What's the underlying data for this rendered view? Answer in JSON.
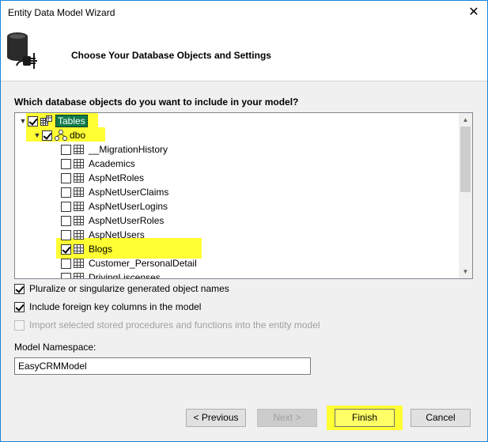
{
  "window": {
    "title": "Entity Data Model Wizard",
    "close_glyph": "✕"
  },
  "header": {
    "title": "Choose Your Database Objects and Settings",
    "icon": "database-plug-icon"
  },
  "objects_section": {
    "label": "Which database objects do you want to include in your model?"
  },
  "tree": {
    "root": {
      "label": "Tables",
      "checked": true,
      "expanded": true,
      "highlighted": true
    },
    "schema": {
      "label": "dbo",
      "checked": true,
      "expanded": true,
      "highlighted": true
    },
    "tables": [
      {
        "label": "__MigrationHistory",
        "checked": false,
        "highlighted": false
      },
      {
        "label": "Academics",
        "checked": false,
        "highlighted": false
      },
      {
        "label": "AspNetRoles",
        "checked": false,
        "highlighted": false
      },
      {
        "label": "AspNetUserClaims",
        "checked": false,
        "highlighted": false
      },
      {
        "label": "AspNetUserLogins",
        "checked": false,
        "highlighted": false
      },
      {
        "label": "AspNetUserRoles",
        "checked": false,
        "highlighted": false
      },
      {
        "label": "AspNetUsers",
        "checked": false,
        "highlighted": false
      },
      {
        "label": "Blogs",
        "checked": true,
        "highlighted": true
      },
      {
        "label": "Customer_PersonalDetail",
        "checked": false,
        "highlighted": false
      },
      {
        "label": "DrivingLiscenses",
        "checked": false,
        "highlighted": false
      }
    ]
  },
  "options": {
    "pluralize": {
      "label": "Pluralize or singularize generated object names",
      "checked": true
    },
    "foreign_keys": {
      "label": "Include foreign key columns in the model",
      "checked": true
    },
    "stored_procs": {
      "label": "Import selected stored procedures and functions into the entity model",
      "checked": false,
      "disabled": true
    }
  },
  "namespace": {
    "label": "Model Namespace:",
    "value": "EasyCRMModel"
  },
  "buttons": {
    "previous": "< Previous",
    "next": "Next >",
    "finish": "Finish",
    "cancel": "Cancel"
  },
  "colors": {
    "highlight": "#ffff33",
    "tables_selection": "#0f7b4a",
    "window_border": "#1883d7"
  }
}
